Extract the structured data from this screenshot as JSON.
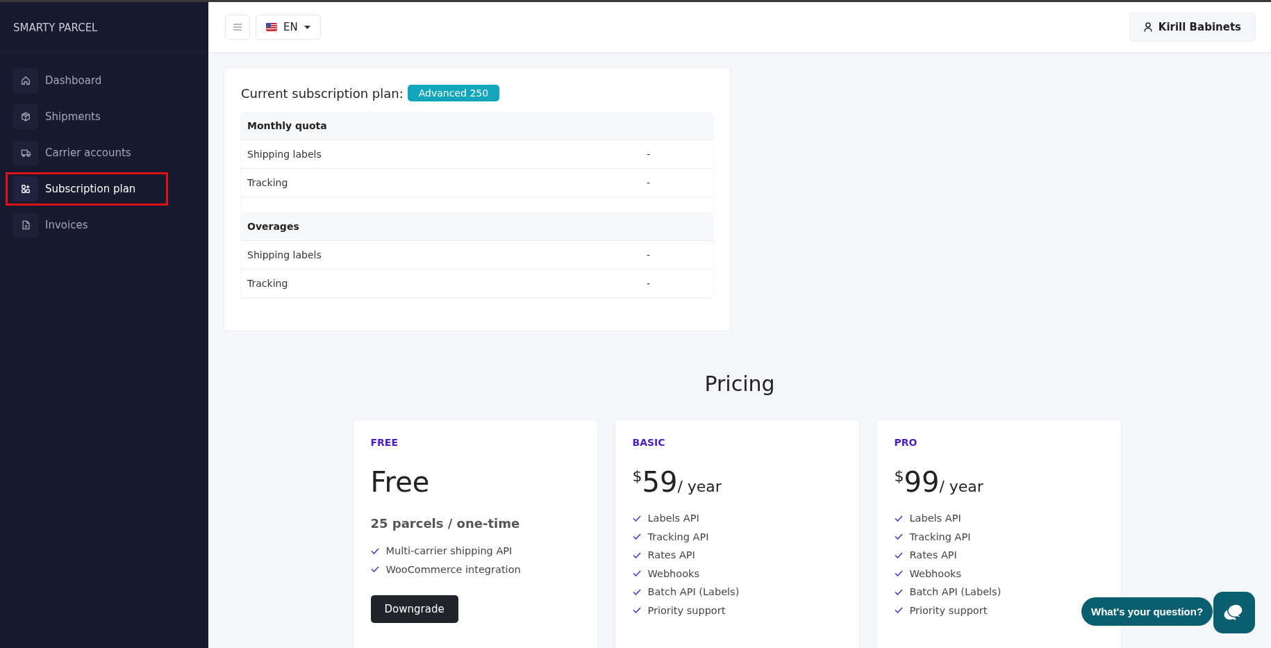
{
  "sidebar": {
    "brand": "SMARTY PARCEL",
    "items": [
      {
        "label": "Dashboard",
        "selected": false,
        "highlighted": false
      },
      {
        "label": "Shipments",
        "selected": false,
        "highlighted": false
      },
      {
        "label": "Carrier accounts",
        "selected": false,
        "highlighted": false
      },
      {
        "label": "Subscription plan",
        "selected": true,
        "highlighted": true
      },
      {
        "label": "Invoices",
        "selected": false,
        "highlighted": false
      }
    ]
  },
  "topbar": {
    "language": "EN",
    "user": "Kirill Babinets"
  },
  "subscription": {
    "title": "Current subscription plan:",
    "plan": "Advanced 250",
    "groups": [
      {
        "heading": "Monthly quota",
        "rows": [
          {
            "label": "Shipping labels",
            "value": "-"
          },
          {
            "label": "Tracking",
            "value": "-"
          }
        ]
      },
      {
        "heading": "Overages",
        "rows": [
          {
            "label": "Shipping labels",
            "value": "-"
          },
          {
            "label": "Tracking",
            "value": "-"
          }
        ]
      }
    ]
  },
  "pricing": {
    "title": "Pricing",
    "plans": [
      {
        "name": "FREE",
        "amount": "Free",
        "subtitle": "25 parcels / one-time",
        "features": [
          "Multi-carrier shipping API",
          "WooCommerce integration"
        ],
        "button": "Downgrade"
      },
      {
        "name": "BASIC",
        "currency": "$",
        "amount": "59",
        "period": "/ year",
        "features": [
          "Labels API",
          "Tracking API",
          "Rates API",
          "Webhooks",
          "Batch API (Labels)",
          "Priority support"
        ]
      },
      {
        "name": "PRO",
        "currency": "$",
        "amount": "99",
        "period": "/ year",
        "features": [
          "Labels API",
          "Tracking API",
          "Rates API",
          "Webhooks",
          "Batch API (Labels)",
          "Priority support"
        ]
      }
    ]
  },
  "chat": {
    "prompt": "What's your question?"
  }
}
